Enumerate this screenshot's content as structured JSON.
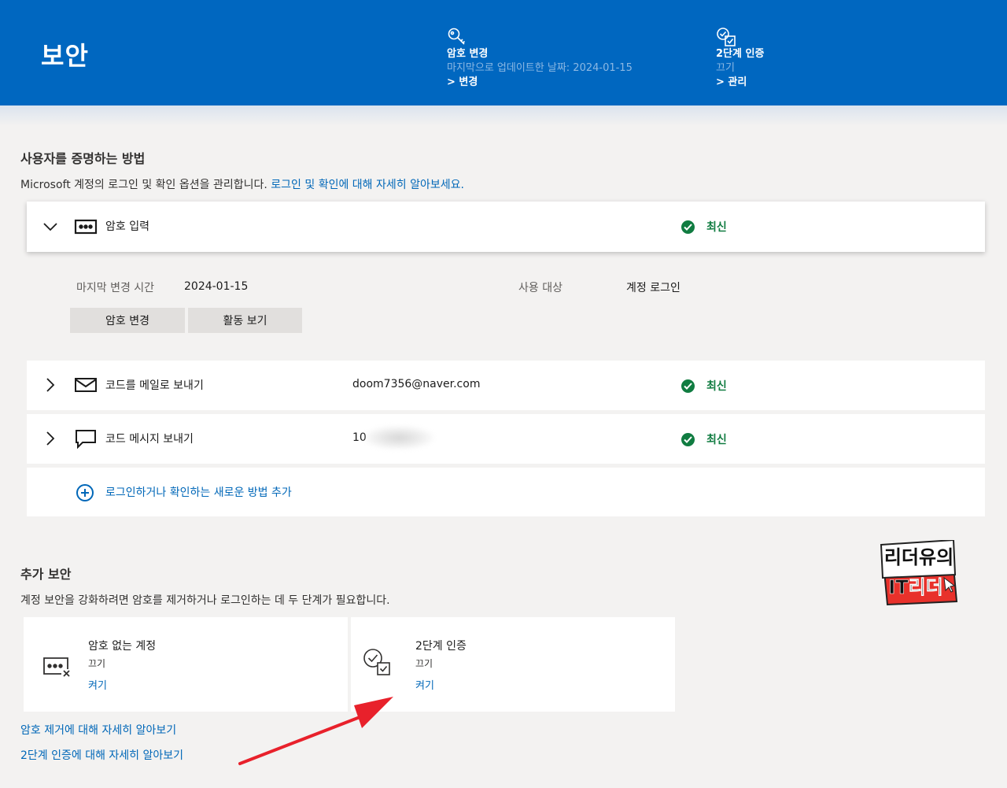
{
  "header": {
    "title": "보안",
    "password": {
      "icon": "key-icon",
      "label": "암호 변경",
      "sub": "마지막으로 업데이트한 날짜: 2024-01-15",
      "link": "> 변경"
    },
    "twofa": {
      "icon": "two-step-verification-icon",
      "label": "2단계 인증",
      "sub": "끄기",
      "link": "> 관리"
    }
  },
  "proof": {
    "title": "사용자를 증명하는 방법",
    "desc": "Microsoft 계정의 로그인 및 확인 옵션을 관리합니다.",
    "desc_link": "로그인 및 확인에 대해 자세히 알아보세요.",
    "methods": [
      {
        "icon": "password-dots-icon",
        "label": "암호 입력",
        "value": "",
        "status": "최신",
        "expanded": true
      },
      {
        "icon": "envelope-icon",
        "label": "코드를 메일로 보내기",
        "value": "doom7356@naver.com",
        "status": "최신"
      },
      {
        "icon": "chat-bubble-icon",
        "label": "코드 메시지 보내기",
        "value": "10",
        "status": "최신"
      }
    ],
    "detail": {
      "last_changed_label": "마지막 변경 시간",
      "last_changed_value": "2024-01-15",
      "used_for_label": "사용 대상",
      "used_for_value": "계정 로그인",
      "change_button": "암호 변경",
      "activity_button": "활동 보기"
    },
    "add_method": {
      "icon": "plus-circle-icon",
      "label": "로그인하거나 확인하는 새로운 방법 추가"
    }
  },
  "additional": {
    "title": "추가 보안",
    "desc": "계정 보안을 강화하려면 암호를 제거하거나 로그인하는 데 두 단계가 필요합니다.",
    "tiles": [
      {
        "icon": "passwordless-icon",
        "title": "암호 없는 계정",
        "state": "끄기",
        "link": "켜기"
      },
      {
        "icon": "two-step-verification-icon",
        "title": "2단계 인증",
        "state": "끄기",
        "link": "켜기"
      }
    ],
    "learn_links": [
      "암호 제거에 대해 자세히 알아보기",
      "2단계 인증에 대해 자세히 알아보기"
    ]
  },
  "watermark": {
    "text_line1": "리더유의",
    "text_line2": "IT리더"
  },
  "colors": {
    "brand": "#0067c0",
    "link": "#0067b8",
    "status": "#107c41",
    "arrow": "#e8212b"
  }
}
